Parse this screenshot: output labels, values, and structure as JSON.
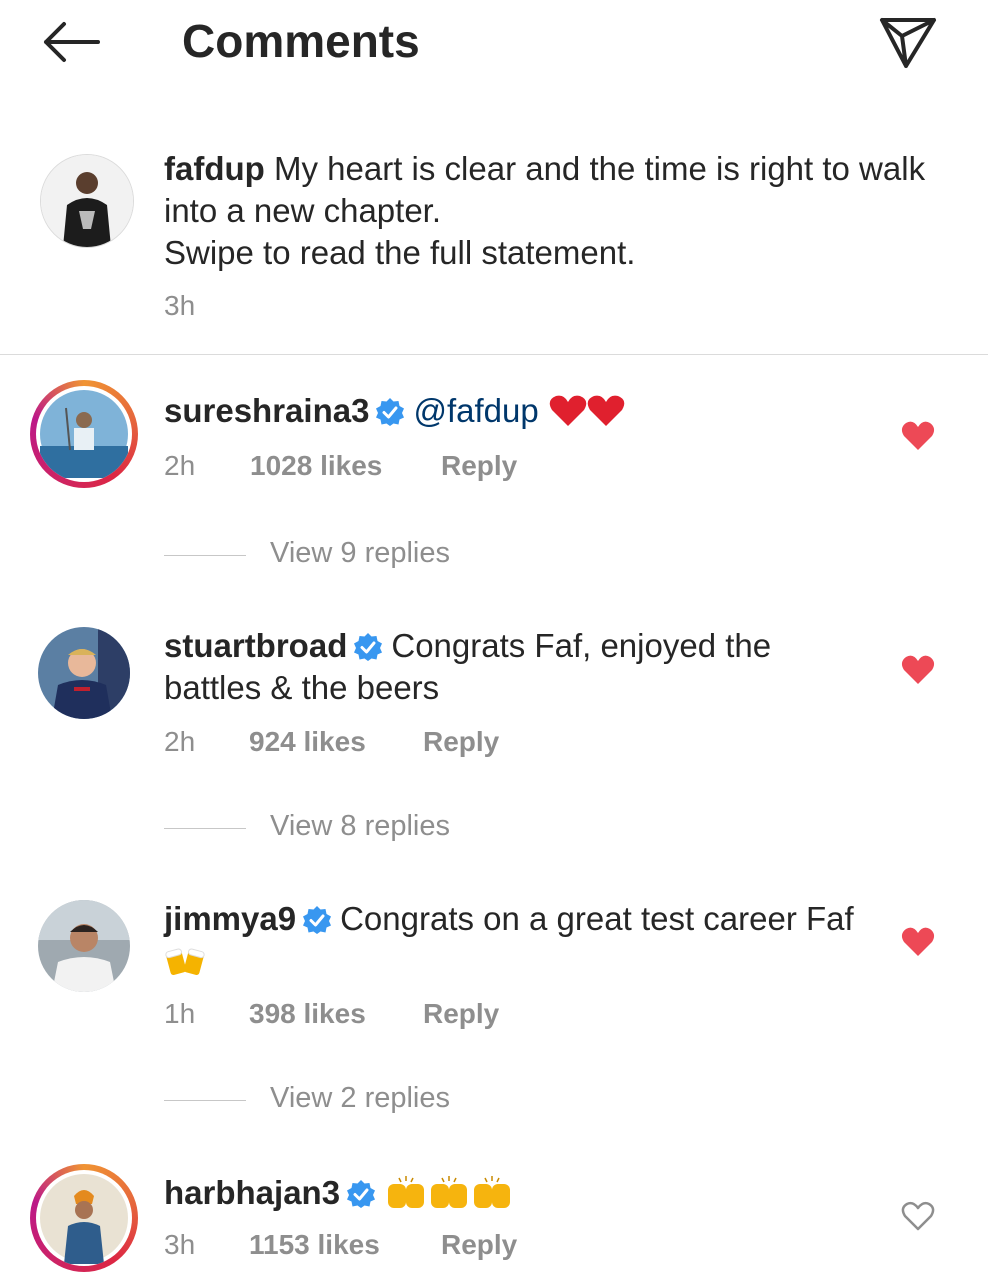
{
  "header": {
    "title": "Comments",
    "back_icon": "arrow-left-icon",
    "share_icon": "paper-plane-icon"
  },
  "post": {
    "username": "fafdup",
    "caption": "My heart is clear and the time is right to walk into a new chapter.\nSwipe to read the full statement.",
    "time": "3h"
  },
  "comments": [
    {
      "username": "sureshraina3",
      "verified": true,
      "text": "@fafdup",
      "emoji": "❤❤",
      "time": "2h",
      "likes": "1028 likes",
      "reply": "Reply",
      "liked": true,
      "view_replies": "View 9 replies"
    },
    {
      "username": "stuartbroad",
      "verified": true,
      "text": "Congrats Faf, enjoyed the battles & the beers",
      "time": "2h",
      "likes": "924 likes",
      "reply": "Reply",
      "liked": true,
      "view_replies": "View 8 replies"
    },
    {
      "username": "jimmya9",
      "verified": true,
      "text": "Congrats on a great test career Faf",
      "emoji": "🍻",
      "time": "1h",
      "likes": "398 likes",
      "reply": "Reply",
      "liked": true,
      "view_replies": "View 2 replies"
    },
    {
      "username": "harbhajan3",
      "verified": true,
      "text": "",
      "emoji": "🙌🙌🙌",
      "time": "3h",
      "likes": "1153 likes",
      "reply": "Reply",
      "liked": false
    }
  ],
  "colors": {
    "text": "#262626",
    "secondary": "#8e8e8e",
    "heart": "#ed4956",
    "verified": "#3897f0",
    "mention": "#00376b"
  }
}
